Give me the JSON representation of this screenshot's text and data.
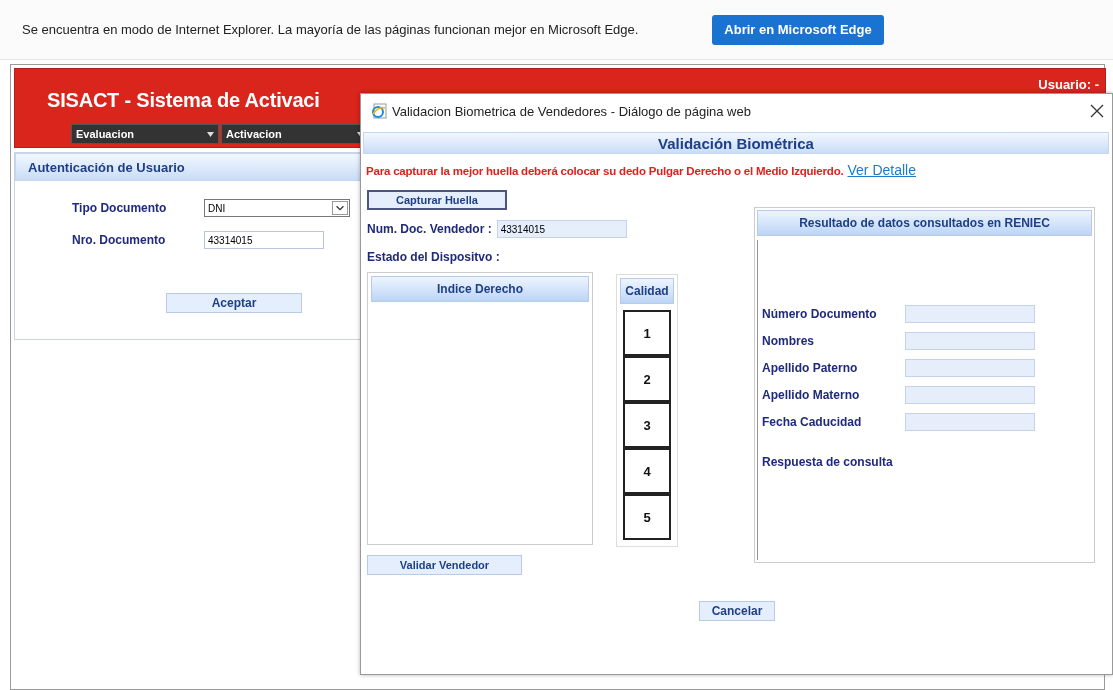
{
  "browser_bar": {
    "message": "Se encuentra en modo de Internet Explorer. La mayoría de las páginas funcionan mejor en Microsoft Edge.",
    "button": "Abrir en Microsoft Edge"
  },
  "app": {
    "title": "SISACT - Sistema de Activaci",
    "user_label": "Usuario: -",
    "menu": [
      {
        "label": "Evaluacion"
      },
      {
        "label": "Activacion"
      }
    ]
  },
  "auth_panel": {
    "title": "Autenticación de Usuario",
    "fields": [
      {
        "kind": "select",
        "label": "Tipo Documento",
        "value": "DNI"
      },
      {
        "kind": "text",
        "label": "Nro. Documento",
        "value": "43314015"
      }
    ],
    "button": "Aceptar"
  },
  "dialog": {
    "title": "Validacion Biometrica de Vendedores - Diálogo de página web",
    "heading": "Validación Biométrica",
    "instruction": "Para capturar la mejor huella deberá colocar su dedo Pulgar Derecho o el Medio Izquierdo.",
    "link": "Ver Detalle",
    "capture_button": "Capturar Huella",
    "vendor_doc": {
      "label": "Num. Doc. Vendedor :",
      "value": "43314015"
    },
    "device_status_label": "Estado del Dispositvo :",
    "finger_panel": {
      "title": "Indice Derecho"
    },
    "quality": {
      "title": "Calidad",
      "levels": [
        "1",
        "2",
        "3",
        "4",
        "5"
      ]
    },
    "validate_button": "Validar Vendedor",
    "reniec": {
      "title": "Resultado de datos consultados en RENIEC",
      "fields": [
        {
          "label": "Número Documento"
        },
        {
          "label": "Nombres"
        },
        {
          "label": "Apellido Paterno"
        },
        {
          "label": "Apellido Materno"
        },
        {
          "label": "Fecha Caducidad"
        }
      ],
      "response_label": "Respuesta de consulta"
    },
    "cancel_button": "Cancelar"
  }
}
